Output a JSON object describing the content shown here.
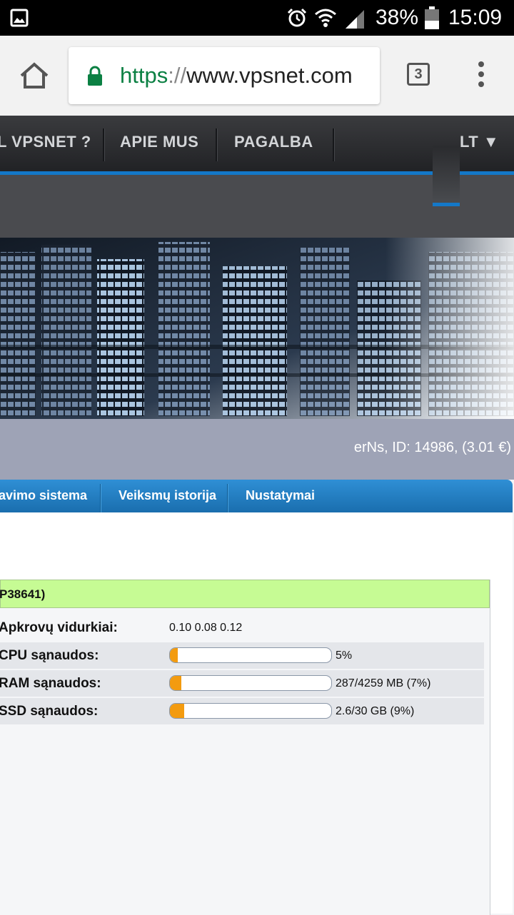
{
  "status_bar": {
    "battery": "38%",
    "time": "15:09",
    "icons": [
      "gallery-icon",
      "alarm-icon",
      "wifi-icon",
      "signal-icon",
      "battery-icon"
    ]
  },
  "browser": {
    "url_scheme": "https",
    "url_sep": "://",
    "url_host": "www.vpsnet.com",
    "tab_count": "3"
  },
  "nav": {
    "items": [
      "L VPSNET ?",
      "APIE MUS",
      "PAGALBA"
    ],
    "lang": "LT ▼"
  },
  "user_info": "erNs, ID: 14986, (3.01 €)",
  "tabs": [
    "avimo sistema",
    "Veiksmų istorija",
    "Nustatymai"
  ],
  "server": {
    "title": "P38641)"
  },
  "stats": {
    "load": {
      "label": "Apkrovų vidurkiai:",
      "value": "0.10 0.08 0.12"
    },
    "cpu": {
      "label": "CPU sąnaudos:",
      "value": "5%",
      "fraction": 0.05
    },
    "ram": {
      "label": "RAM sąnaudos:",
      "value": "287/4259 MB (7%)",
      "fraction": 0.07
    },
    "ssd": {
      "label": "SSD sąnaudos:",
      "value": "2.6/30 GB (9%)",
      "fraction": 0.09
    }
  },
  "colors": {
    "accent_blue": "#1478c8",
    "bar_orange": "#f39b0f",
    "server_green": "#c6fb94"
  }
}
